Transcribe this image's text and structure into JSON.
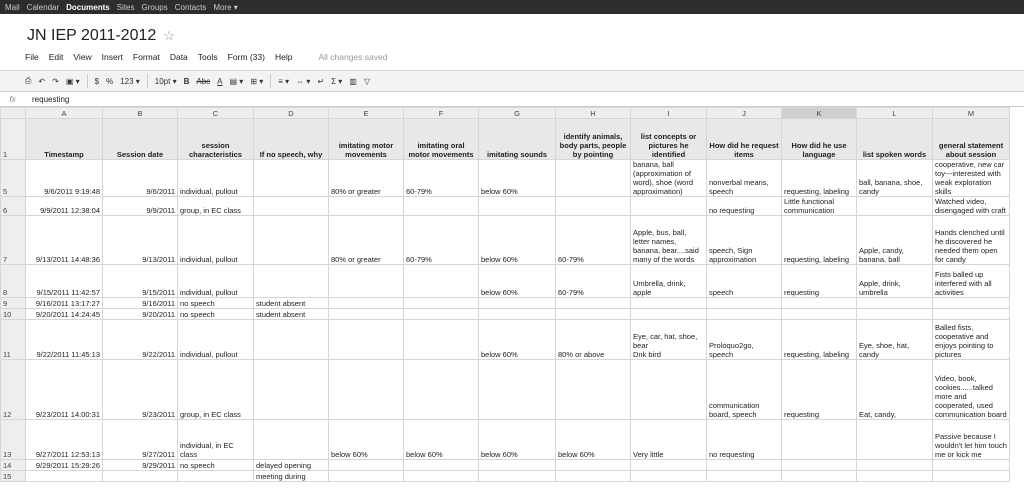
{
  "topnav": [
    "Mail",
    "Calendar",
    "Documents",
    "Sites",
    "Groups",
    "Contacts",
    "More ▾"
  ],
  "active_nav": "Documents",
  "title": "JN IEP 2011-2012",
  "menu": [
    "File",
    "Edit",
    "View",
    "Insert",
    "Format",
    "Data",
    "Tools",
    "Form (33)",
    "Help"
  ],
  "save_status": "All changes saved",
  "toolbar": {
    "currency": "$",
    "percent": "%",
    "number_format": "123 ▾",
    "font_size": "10pt ▾",
    "bold": "B",
    "strike": "Abc",
    "text_color": "A",
    "sigma": "Σ ▾"
  },
  "formula": {
    "fx": "fx",
    "value": "requesting"
  },
  "columns": [
    "A",
    "B",
    "C",
    "D",
    "E",
    "F",
    "G",
    "H",
    "I",
    "J",
    "K",
    "L",
    "M"
  ],
  "selected_column": "K",
  "rows": [
    {
      "n": "1",
      "header": true,
      "cells": [
        "Timestamp",
        "Session date",
        "session characteristics",
        "If no speech, why",
        "imitating motor movements",
        "imitating oral motor movements",
        "imitating sounds",
        "identify animals, body parts, people by pointing",
        "list concepts or pictures he identified",
        "How did he request items",
        "How did he use language",
        "list spoken words",
        "general statement about session"
      ]
    },
    {
      "n": "5",
      "cells": [
        "9/6/2011 9:19:48",
        "9/6/2011",
        "individual, pullout",
        "",
        "80% or greater",
        "60-79%",
        "below 60%",
        "",
        "banana, ball (approximation of word), shoe (word approximation)",
        "nonverbal means, speech",
        "requesting, labeling",
        "ball, banana, shoe, candy",
        "cooperative, new car toy---interested with weak exploration skills"
      ]
    },
    {
      "n": "6",
      "cells": [
        "9/9/2011 12:38:04",
        "9/9/2011",
        "group, in EC class",
        "",
        "",
        "",
        "",
        "",
        "",
        "no requesting",
        "Little functional communication",
        "",
        "Watched video, disengaged with craft"
      ]
    },
    {
      "n": "7",
      "cells": [
        "9/13/2011 14:48:36",
        "9/13/2011",
        "individual, pullout",
        "",
        "80% or greater",
        "60-79%",
        "below 60%",
        "60-79%",
        "Apple, bus, ball, letter names, banana, bear....said many of the words",
        "speech, Sign approximation",
        "requesting, labeling",
        "Apple, candy, banana, ball",
        "Hands clenched until he discovered he needed them open for candy"
      ]
    },
    {
      "n": "8",
      "cells": [
        "9/15/2011 11:42:57",
        "9/15/2011",
        "individual, pullout",
        "",
        "",
        "",
        "below 60%",
        "60-79%",
        "Umbrella, drink, apple",
        "speech",
        "requesting",
        "Apple, drink, umbrella",
        "Fists balled up interfered with all activities"
      ]
    },
    {
      "n": "9",
      "cells": [
        "9/16/2011 13:17:27",
        "9/16/2011",
        "no speech",
        "student absent",
        "",
        "",
        "",
        "",
        "",
        "",
        "",
        "",
        ""
      ]
    },
    {
      "n": "10",
      "cells": [
        "9/20/2011 14:24:45",
        "9/20/2011",
        "no speech",
        "student absent",
        "",
        "",
        "",
        "",
        "",
        "",
        "",
        "",
        ""
      ]
    },
    {
      "n": "11",
      "cells": [
        "9/22/2011 11:45:13",
        "9/22/2011",
        "individual, pullout",
        "",
        "",
        "",
        "below 60%",
        "80% or above",
        "Eye, car, hat, shoe, bear\nDnk bird",
        "Proloquo2go, speech",
        "requesting, labeling",
        "Eye, shoe, hat, candy",
        "Balled fists, cooperative and enjoys pointing to pictures"
      ]
    },
    {
      "n": "12",
      "cells": [
        "9/23/2011 14:00:31",
        "9/23/2011",
        "group, in EC class",
        "",
        "",
        "",
        "",
        "",
        "",
        "communication board, speech",
        "requesting",
        "Eat, candy,",
        "Video, book, cookies......talked more and cooperated, used communication board"
      ]
    },
    {
      "n": "13",
      "cells": [
        "9/27/2011 12:53:13",
        "9/27/2011",
        "individual, in EC class",
        "",
        "below 60%",
        "below 60%",
        "below 60%",
        "below 60%",
        "Very little",
        "no requesting",
        "",
        "",
        "Passive because I wouldn't let him touch me or kick me"
      ]
    },
    {
      "n": "14",
      "cells": [
        "9/29/2011 15:29:26",
        "9/29/2011",
        "no speech",
        "delayed opening",
        "",
        "",
        "",
        "",
        "",
        "",
        "",
        "",
        ""
      ]
    },
    {
      "n": "15",
      "cells": [
        "",
        "",
        "",
        "meeting during",
        "",
        "",
        "",
        "",
        "",
        "",
        "",
        "",
        ""
      ]
    }
  ]
}
